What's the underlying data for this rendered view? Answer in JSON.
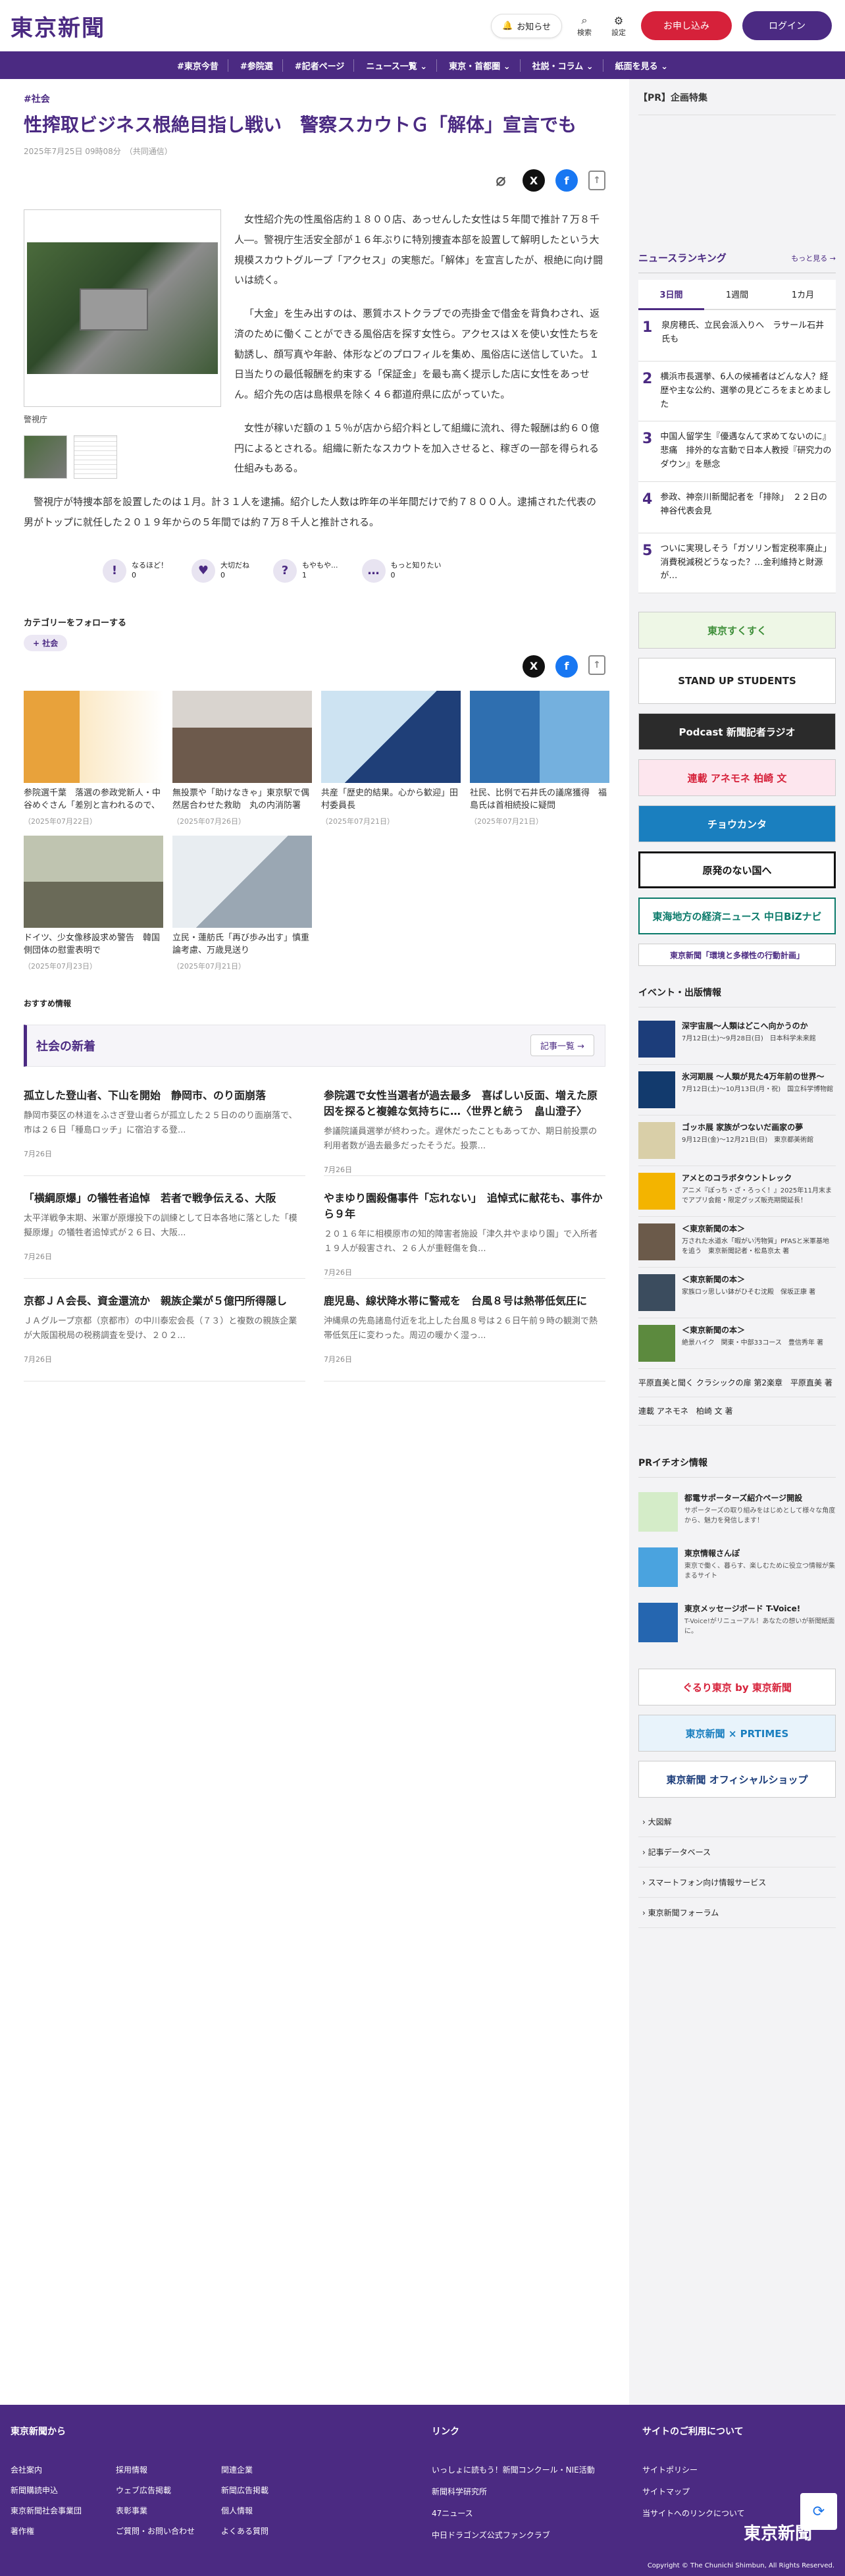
{
  "header": {
    "logo": "東京新聞",
    "notify": "お知らせ",
    "search": "検索",
    "settings": "設定",
    "subscribe": "お申し込み",
    "login": "ログイン"
  },
  "gnav": [
    "#東京今昔",
    "#参院選",
    "#記者ページ",
    "ニュース一覧 ⌄",
    "東京・首都圏 ⌄",
    "社説・コラム ⌄",
    "紙面を見る ⌄"
  ],
  "article": {
    "tag": "#社会",
    "title": "性搾取ビジネス根絶目指し戦い　警察スカウトＧ「解体」宣言でも",
    "date": "2025年7月25日 09時08分　（共同通信）",
    "caption": "警視庁",
    "paragraphs": [
      "女性紹介先の性風俗店約１８００店、あっせんした女性は５年間で推計７万８千人―。警視庁生活安全部が１６年ぶりに特別捜査本部を設置して解明したという大規模スカウトグループ「アクセス」の実態だ。「解体」を宣言したが、根絶に向け闘いは続く。",
      "「大金」を生み出すのは、悪質ホストクラブでの売掛金で借金を背負わされ、返済のために働くことができる風俗店を探す女性ら。アクセスはＸを使い女性たちを勧誘し、顔写真や年齢、体形などのプロフィルを集め、風俗店に送信していた。１日当たりの最低報酬を約束する「保証金」を最も高く提示した店に女性をあっせん。紹介先の店は島根県を除く４６都道府県に広がっていた。",
      "女性が稼いだ額の１５％が店から紹介料として組織に流れ、得た報酬は約６０億円によるとされる。組織に新たなスカウトを加入させると、稼ぎの一部を得られる仕組みもある。"
    ],
    "full_paragraph": "警視庁が特捜本部を設置したのは１月。計３１人を逮捕。紹介した人数は昨年の半年間だけで約７８００人。逮捕された代表の男がトップに就任した２０１９年からの５年間では約７万８千人と推計される。",
    "reactions": [
      {
        "icon": "!",
        "label": "なるほど！",
        "count": "0"
      },
      {
        "icon": "♥",
        "label": "大切だね",
        "count": "0"
      },
      {
        "icon": "?",
        "label": "もやもや...",
        "count": "1"
      },
      {
        "icon": "…",
        "label": "もっと知りたい",
        "count": "0"
      }
    ],
    "follow_label": "カテゴリーをフォローする",
    "follow_chip": "+ 社会"
  },
  "related": [
    {
      "title": "参院選千葉　落選の参政党新人・中谷めぐさん「差別と言われるので、言えなかった」選挙演...",
      "date": "（2025年07月22日）"
    },
    {
      "title": "無投票や「助けなきゃ」東京駅で偶然居合わせた救助　丸の内消防署　4人に感謝状",
      "date": "（2025年07月26日）"
    },
    {
      "title": "共産「歴史的結果。心から歓迎」田村委員長",
      "date": "（2025年07月21日）"
    },
    {
      "title": "社民、比例で石井氏の議席獲得　福島氏は首相続投に疑問",
      "date": "（2025年07月21日）"
    },
    {
      "title": "ドイツ、少女像移設求め警告　韓国側団体の慰霊表明で",
      "date": "（2025年07月23日）"
    },
    {
      "title": "立民・蓮舫氏「再び歩み出す」慎重論考慮、万歳見送り",
      "date": "（2025年07月21日）"
    }
  ],
  "recommend_label": "おすすめ情報",
  "news": {
    "heading": "社会の新着",
    "more": "記事一覧 →",
    "items": [
      {
        "title": "孤立した登山者、下山を開始　静岡市、のり面崩落",
        "summary": "静岡市葵区の林道をふさぎ登山者らが孤立した２５日ののり面崩落で、市は２６日「種島ロッチ」に宿泊する登...",
        "date": "7月26日"
      },
      {
        "title": "参院選で女性当選者が過去最多　喜ばしい反面、増えた原因を探ると複雑な気持ちに…〈世界と統う　畠山澄子〉",
        "summary": "参議院議員選挙が終わった。遅休だったこともあってか、期日前投票の利用者数が過去最多だったそうだ。投票...",
        "date": "7月26日"
      },
      {
        "title": "「横綱原爆」の犠牲者追悼　若者で戦争伝える、大阪",
        "summary": "太平洋戦争末期、米軍が原爆投下の訓練として日本各地に落とした「模擬原爆」の犠牲者追悼式が２６日、大阪...",
        "date": "7月26日"
      },
      {
        "title": "やまゆり園殺傷事件「忘れない」　追悼式に献花も、事件から９年",
        "summary": "２０１６年に相模原市の知的障害者施設「津久井やまゆり園」で入所者１９人が殺害され、２６人が重軽傷を負...",
        "date": "7月26日"
      },
      {
        "title": "京都ＪＡ会長、資金還流か　親族企業が５億円所得隠し",
        "summary": "ＪＡグループ京都（京都市）の中川泰宏会長（７３）と複数の親族企業が大阪国税局の税務調査を受け、２０２...",
        "date": "7月26日"
      },
      {
        "title": "鹿児島、線状降水帯に警戒を　台風８号は熱帯低気圧に",
        "summary": "沖縄県の先島諸島付近を北上した台風８号は２６日午前９時の観測で熱帯低気圧に変わった。周辺の暖かく湿っ...",
        "date": "7月26日"
      }
    ]
  },
  "sidebar": {
    "pr_title": "【PR】企画特集",
    "ranking": {
      "heading": "ニュースランキング",
      "more": "もっと見る →",
      "tabs": [
        "3日間",
        "1週間",
        "1カ月"
      ],
      "items": [
        {
          "n": "1",
          "title": "泉房穂氏、立民会派入りへ　ラサール石井氏も"
        },
        {
          "n": "2",
          "title": "横浜市長選挙、6人の候補者はどんな人？経歴や主な公約、選挙の見どころをまとめました"
        },
        {
          "n": "3",
          "title": "中国人留学生『優遇なんて求めてないのに』悲痛　排外的な言動で日本人教授『研究力のダウン』を懸念"
        },
        {
          "n": "4",
          "title": "参政、神奈川新聞記者を「排除」　２２日の神谷代表会見"
        },
        {
          "n": "5",
          "title": "ついに実現しそう「ガソリン暫定税率廃止」消費税減税どうなった？…金利維持と財源が…"
        }
      ]
    },
    "banners": [
      "東京すくすく",
      "STAND UP STUDENTS",
      "Podcast 新聞記者ラジオ",
      "連載 アネモネ 柏崎 文",
      "チョウカンタ",
      "原発のない国へ",
      "東海地方の経済ニュース 中日BiZナビ",
      "東京新聞「環境と多様性の行動計画」"
    ],
    "events_title": "イベント・出版情報",
    "events": [
      {
        "title": "深宇宙展〜人類はどこへ向かうのか",
        "sub": "7月12日(土)〜9月28日(日)　日本科学未来館"
      },
      {
        "title": "氷河期展 〜人類が見た4万年前の世界〜",
        "sub": "7月12日(土)〜10月13日(月・祝)　国立科学博物館"
      },
      {
        "title": "ゴッホ展 家族がつないだ画家の夢",
        "sub": "9月12日(金)〜12月21日(日)　東京都美術館"
      },
      {
        "title": "アメとのコラボタウントレック",
        "sub": "アニメ『ぽっち・ざ・ろっく！』2025年11月末までアプリ会館・限定グッズ販売期間延長！"
      },
      {
        "title": "＜東京新聞の本＞",
        "sub": "万された水道水「暇がい汚物質」PFASと米軍基地を追う　東京新聞記者・松島京太 著"
      },
      {
        "title": "＜東京新聞の本＞",
        "sub": "家族ロッ思しい鉢がひそむ沈殿　保坂正康 著"
      },
      {
        "title": "＜東京新聞の本＞",
        "sub": "絶景ハイク　関東・中部33コース　豊信秀年 著"
      }
    ],
    "text_links": [
      "平原直美と聞く クラシックの扉 第2楽章　平原直美 著",
      "連載 アネモネ　柏崎 文 著"
    ],
    "pr_info_title": "PRイチオシ情報",
    "pr_items": [
      {
        "title": "都電サポーターズ紹介ページ開設",
        "sub": "サポーターズの取り組みをはじめとして様々な角度から、魅力を発信します！"
      },
      {
        "title": "東京情報さんぽ",
        "sub": "東京で働く、暮らす、楽しむために役立つ情報が集まるサイト"
      },
      {
        "title": "東京メッセージボード T-Voice!",
        "sub": "T-Voice!がリニューアル！あなたの想いが新聞紙面に。"
      }
    ],
    "banners2": [
      "ぐるり東京 by 東京新聞",
      "東京新聞 × PRTIMES",
      "東京新聞 オフィシャルショップ"
    ],
    "links": [
      "大図解",
      "記事データベース",
      "スマートフォン向け情報サービス",
      "東京新聞フォーラム"
    ]
  },
  "footer": {
    "col1_title": "東京新聞から",
    "col1": [
      "会社案内",
      "採用情報",
      "関連企業",
      "新聞購読申込",
      "ウェブ広告掲載",
      "新聞広告掲載",
      "東京新聞社会事業団",
      "表彰事業",
      "個人情報",
      "著作権",
      "ご質問・お問い合わせ",
      "よくある質問"
    ],
    "col2_title": "リンク",
    "col2": [
      "いっしょに読もう！新聞コンクール・NIE活動",
      "新聞科学研究所",
      "47ニュース",
      "中日ドラゴンズ公式ファンクラブ"
    ],
    "col3_title": "サイトのご利用について",
    "col3": [
      "サイトポリシー",
      "サイトマップ",
      "当サイトへのリンクについて"
    ],
    "logo": "東京新聞",
    "copyright": "Copyright © The Chunichi Shimbun, All Rights Reserved."
  },
  "colors": {
    "brand": "#4b2a82",
    "subscribe": "#d6213a"
  }
}
